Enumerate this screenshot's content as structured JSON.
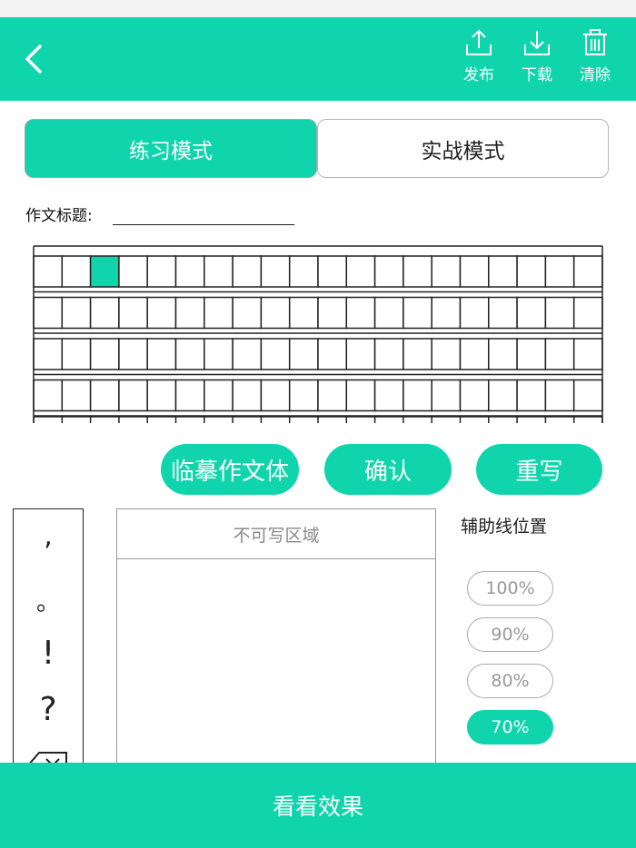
{
  "header": {
    "actions": [
      {
        "label": "发布",
        "icon": "upload-icon"
      },
      {
        "label": "下载",
        "icon": "download-icon"
      },
      {
        "label": "清除",
        "icon": "trash-icon"
      }
    ]
  },
  "modes": {
    "practice": "练习模式",
    "combat": "实战模式",
    "selected": "practice"
  },
  "essay": {
    "title_label": "作文标题:",
    "title_value": ""
  },
  "grid": {
    "rows_visible": 4,
    "columns": 20,
    "highlighted_cell": {
      "row": 1,
      "column": 3
    },
    "highlight_color": "#10d4ac"
  },
  "actions": {
    "copy_label": "临摹作文体",
    "confirm_label": "确认",
    "rewrite_label": "重写"
  },
  "punctuation": [
    ",",
    "。",
    "!",
    "?"
  ],
  "write_area": {
    "header": "不可写区域"
  },
  "aux_lines": {
    "title": "辅助线位置",
    "options": [
      "100%",
      "90%",
      "80%",
      "70%"
    ],
    "selected": "70%"
  },
  "footer": {
    "preview_label": "看看效果"
  },
  "colors": {
    "accent": "#10d4ac"
  }
}
